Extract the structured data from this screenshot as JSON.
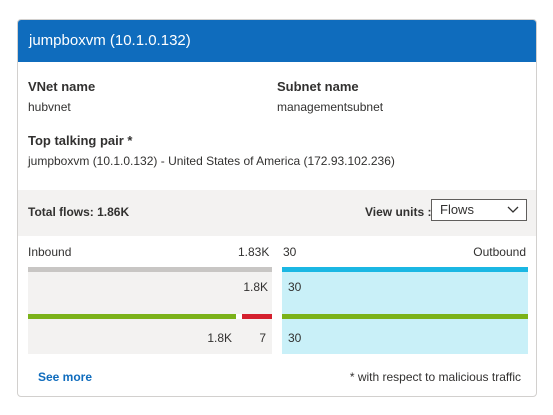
{
  "header": {
    "title": "jumpboxvm (10.1.0.132)"
  },
  "info": {
    "vnet_label": "VNet name",
    "vnet_value": "hubvnet",
    "subnet_label": "Subnet name",
    "subnet_value": "managementsubnet",
    "pair_label": "Top talking pair *",
    "pair_value": "jumpboxvm (10.1.0.132) - United States of America (172.93.102.236)"
  },
  "toolbar": {
    "total_flows": "Total flows: 1.86K",
    "view_units_label": "View units :",
    "view_units_selected": "Flows"
  },
  "flows": {
    "inbound_label": "Inbound",
    "outbound_label": "Outbound",
    "inbound_total": "1.83K",
    "outbound_total": "30",
    "inbound_row1_value": "1.8K",
    "outbound_row1_value": "30",
    "inbound_row2_benign": "1.8K",
    "inbound_row2_malicious": "7",
    "outbound_row2_value": "30"
  },
  "footer": {
    "see_more": "See more",
    "note": "* with respect to malicious traffic"
  },
  "colors": {
    "header_bg": "#0f6cbd",
    "inbound_bar": "#c8c6c4",
    "outbound_bar": "#1bb7e3",
    "outbound_fill": "#c9f0f8",
    "benign_bar": "#7bb21a",
    "malicious_bar": "#d4202e",
    "inbound_fill": "#f3f2f1"
  }
}
